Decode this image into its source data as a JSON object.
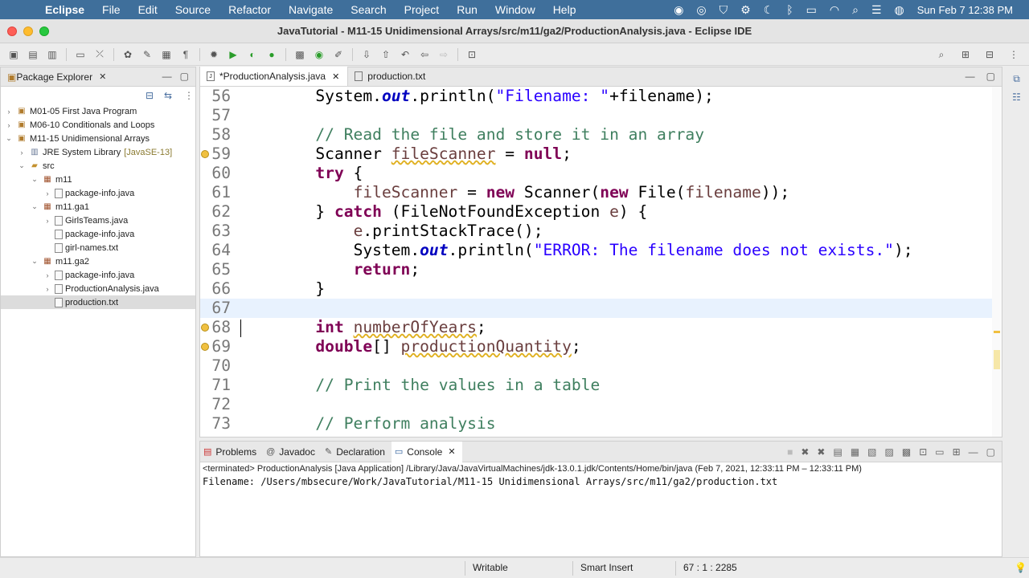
{
  "menubar": {
    "app": "Eclipse",
    "items": [
      "File",
      "Edit",
      "Source",
      "Refactor",
      "Navigate",
      "Search",
      "Project",
      "Run",
      "Window",
      "Help"
    ],
    "clock": "Sun Feb 7  12:38 PM"
  },
  "window": {
    "title": "JavaTutorial - M11-15 Unidimensional Arrays/src/m11/ga2/ProductionAnalysis.java - Eclipse IDE"
  },
  "explorer": {
    "tab_label": "Package Explorer",
    "tree": [
      {
        "label": "M01-05 First Java Program",
        "indent": 0,
        "arrow": "›",
        "icon": "project"
      },
      {
        "label": "M06-10 Conditionals and Loops",
        "indent": 0,
        "arrow": "›",
        "icon": "project"
      },
      {
        "label": "M11-15 Unidimensional Arrays",
        "indent": 0,
        "arrow": "⌄",
        "icon": "project"
      },
      {
        "label": "JRE System Library",
        "deco": "[JavaSE-13]",
        "indent": 1,
        "arrow": "›",
        "icon": "lib"
      },
      {
        "label": "src",
        "indent": 1,
        "arrow": "⌄",
        "icon": "folder"
      },
      {
        "label": "m11",
        "indent": 2,
        "arrow": "⌄",
        "icon": "pkg"
      },
      {
        "label": "package-info.java",
        "indent": 3,
        "arrow": "›",
        "icon": "file"
      },
      {
        "label": "m11.ga1",
        "indent": 2,
        "arrow": "⌄",
        "icon": "pkg"
      },
      {
        "label": "GirlsTeams.java",
        "indent": 3,
        "arrow": "›",
        "icon": "file"
      },
      {
        "label": "package-info.java",
        "indent": 3,
        "arrow": "",
        "icon": "file"
      },
      {
        "label": "girl-names.txt",
        "indent": 3,
        "arrow": "",
        "icon": "file"
      },
      {
        "label": "m11.ga2",
        "indent": 2,
        "arrow": "⌄",
        "icon": "pkg"
      },
      {
        "label": "package-info.java",
        "indent": 3,
        "arrow": "›",
        "icon": "file"
      },
      {
        "label": "ProductionAnalysis.java",
        "indent": 3,
        "arrow": "›",
        "icon": "file"
      },
      {
        "label": "production.txt",
        "indent": 3,
        "arrow": "",
        "icon": "file",
        "selected": true
      }
    ]
  },
  "editor": {
    "tabs": [
      "*ProductionAnalysis.java",
      "production.txt"
    ],
    "lines": [
      {
        "n": "56",
        "warn": false
      },
      {
        "n": "57",
        "warn": false
      },
      {
        "n": "58",
        "warn": false
      },
      {
        "n": "59",
        "warn": true
      },
      {
        "n": "60",
        "warn": false
      },
      {
        "n": "61",
        "warn": false
      },
      {
        "n": "62",
        "warn": false
      },
      {
        "n": "63",
        "warn": false
      },
      {
        "n": "64",
        "warn": false
      },
      {
        "n": "65",
        "warn": false
      },
      {
        "n": "66",
        "warn": false
      },
      {
        "n": "67",
        "warn": false,
        "current": true
      },
      {
        "n": "68",
        "warn": true
      },
      {
        "n": "69",
        "warn": true
      },
      {
        "n": "70",
        "warn": false
      },
      {
        "n": "71",
        "warn": false
      },
      {
        "n": "72",
        "warn": false
      },
      {
        "n": "73",
        "warn": false
      }
    ],
    "code": {
      "l56_a": "System.",
      "l56_b": "out",
      "l56_c": ".println(",
      "l56_d": "\"Filename: \"",
      "l56_e": "+filename);",
      "l58": "// Read the file and store it in an array",
      "l59_a": "Scanner ",
      "l59_b": "fileScanner",
      "l59_c": " = ",
      "l59_d": "null",
      "l59_e": ";",
      "l60_a": "try",
      "l60_b": " {",
      "l61_a": "fileScanner",
      "l61_b": " = ",
      "l61_c": "new",
      "l61_d": " Scanner(",
      "l61_e": "new",
      "l61_f": " File(",
      "l61_g": "filename",
      "l61_h": "));",
      "l62_a": "} ",
      "l62_b": "catch",
      "l62_c": " (FileNotFoundException ",
      "l62_d": "e",
      "l62_e": ") {",
      "l63_a": "e",
      "l63_b": ".printStackTrace();",
      "l64_a": "System.",
      "l64_b": "out",
      "l64_c": ".println(",
      "l64_d": "\"ERROR: The filename does not exists.\"",
      "l64_e": ");",
      "l65_a": "return",
      "l65_b": ";",
      "l66": "}",
      "l68_a": "int",
      "l68_b": " ",
      "l68_c": "numberOfYears",
      "l68_d": ";",
      "l69_a": "double",
      "l69_b": "[] ",
      "l69_c": "productionQuantity",
      "l69_d": ";",
      "l71": "// Print the values in a table",
      "l73": "// Perform analysis"
    }
  },
  "console": {
    "tabs": [
      "Problems",
      "Javadoc",
      "Declaration",
      "Console"
    ],
    "terminated": "<terminated> ProductionAnalysis [Java Application] /Library/Java/JavaVirtualMachines/jdk-13.0.1.jdk/Contents/Home/bin/java  (Feb 7, 2021, 12:33:11 PM – 12:33:11 PM)",
    "output": "Filename: /Users/mbsecure/Work/JavaTutorial/M11-15 Unidimensional Arrays/src/m11/ga2/production.txt"
  },
  "status": {
    "writable": "Writable",
    "insert_mode": "Smart Insert",
    "position": "67 : 1 : 2285"
  }
}
